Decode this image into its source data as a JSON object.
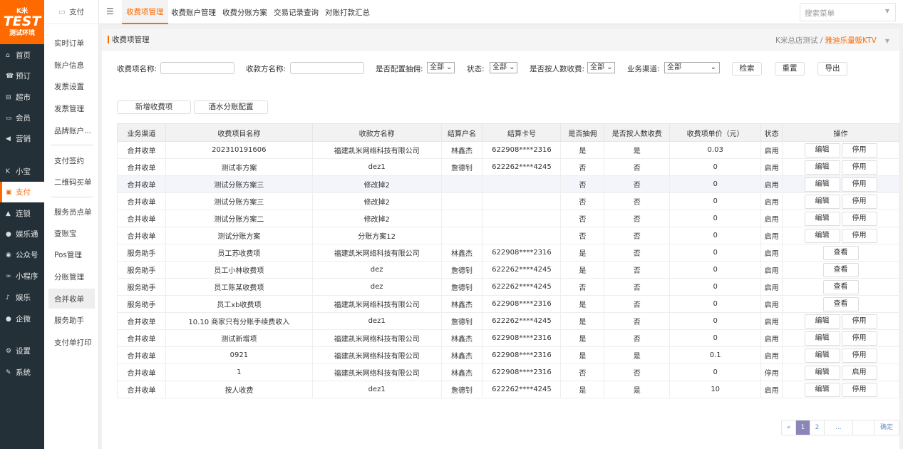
{
  "logo": {
    "top": "K米",
    "main": "TEST",
    "sub": "测试环境"
  },
  "nav": [
    {
      "label": "首页",
      "icon": "home-icon",
      "g": "⌂"
    },
    {
      "label": "预订",
      "icon": "booking-icon",
      "g": "☎"
    },
    {
      "label": "超市",
      "icon": "basket-icon",
      "g": "⊟"
    },
    {
      "label": "会员",
      "icon": "card-icon",
      "g": "▭"
    },
    {
      "label": "营销",
      "icon": "megaphone-icon",
      "g": "◀"
    },
    {
      "label": "小宝",
      "icon": "xiaobao-icon",
      "g": "K"
    },
    {
      "label": "支付",
      "icon": "payment-icon",
      "g": "▣"
    },
    {
      "label": "连锁",
      "icon": "bag-icon",
      "g": "▲"
    },
    {
      "label": "娱乐通",
      "icon": "user-icon",
      "g": "●"
    },
    {
      "label": "公众号",
      "icon": "wechat-icon",
      "g": "◉"
    },
    {
      "label": "小程序",
      "icon": "miniprogram-icon",
      "g": "∞"
    },
    {
      "label": "娱乐",
      "icon": "music-icon",
      "g": "♪"
    },
    {
      "label": "企微",
      "icon": "wecom-icon",
      "g": "●"
    },
    {
      "label": "设置",
      "icon": "gear-icon",
      "g": "⚙"
    },
    {
      "label": "系统",
      "icon": "wrench-icon",
      "g": "✎"
    }
  ],
  "subnav": {
    "title": "支付",
    "items": [
      "实时订单",
      "账户信息",
      "发票设置",
      "发票管理",
      "品牌账户...",
      "支付签约",
      "二维码买单",
      "服务员点单",
      "查账宝",
      "Pos管理",
      "分账管理",
      "合并收单",
      "服务助手",
      "支付单打印"
    ]
  },
  "tabs": [
    "收费项管理",
    "收费账户管理",
    "收费分账方案",
    "交易记录查询",
    "对账打款汇总"
  ],
  "search_placeholder": "搜索菜单",
  "page_title": "收费项管理",
  "breadcrumb": {
    "store": "K米总店测试",
    "sep": "/",
    "current": "雅迪乐量贩KTV"
  },
  "filters": {
    "item_name": "收费项名称:",
    "payee": "收款方名称:",
    "commission": "是否配置抽佣:",
    "commission_val": "全部",
    "status": "状态:",
    "status_val": "全部",
    "per_person": "是否按人数收费:",
    "per_person_val": "全部",
    "channel": "业务渠道:",
    "channel_val": "全部",
    "search": "检索",
    "reset": "重置",
    "export": "导出"
  },
  "actions": {
    "add": "新增收费项",
    "drink": "酒水分账配置"
  },
  "columns": [
    "业务渠道",
    "收费项目名称",
    "收款方名称",
    "结算户名",
    "结算卡号",
    "是否抽佣",
    "是否按人数收费",
    "收费项单价（元）",
    "状态",
    "操作"
  ],
  "rows": [
    [
      "合并收单",
      "202310191606",
      "福建凯米网络科技有限公司",
      "林鑫杰",
      "622908****2316",
      "是",
      "是",
      "0.03",
      "启用",
      [
        "编辑",
        "停用"
      ]
    ],
    [
      "合并收单",
      "测试非方案",
      "dez1",
      "詹德钊",
      "622262****4245",
      "否",
      "否",
      "0",
      "启用",
      [
        "编辑",
        "停用"
      ]
    ],
    [
      "合并收单",
      "测试分账方案三",
      "修改掉2",
      "",
      "",
      "否",
      "否",
      "0",
      "启用",
      [
        "编辑",
        "停用"
      ]
    ],
    [
      "合并收单",
      "测试分账方案三",
      "修改掉2",
      "",
      "",
      "否",
      "否",
      "0",
      "启用",
      [
        "编辑",
        "停用"
      ]
    ],
    [
      "合并收单",
      "测试分账方案二",
      "修改掉2",
      "",
      "",
      "否",
      "否",
      "0",
      "启用",
      [
        "编辑",
        "停用"
      ]
    ],
    [
      "合并收单",
      "测试分账方案",
      "分账方案12",
      "",
      "",
      "否",
      "否",
      "0",
      "启用",
      [
        "编辑",
        "停用"
      ]
    ],
    [
      "服务助手",
      "员工苏收费项",
      "福建凯米网络科技有限公司",
      "林鑫杰",
      "622908****2316",
      "是",
      "否",
      "0",
      "启用",
      [
        "查看"
      ]
    ],
    [
      "服务助手",
      "员工小林收费项",
      "dez",
      "詹德钊",
      "622262****4245",
      "是",
      "否",
      "0",
      "启用",
      [
        "查看"
      ]
    ],
    [
      "服务助手",
      "员工陈某收费项",
      "dez",
      "詹德钊",
      "622262****4245",
      "否",
      "否",
      "0",
      "启用",
      [
        "查看"
      ]
    ],
    [
      "服务助手",
      "员工xb收费项",
      "福建凯米网络科技有限公司",
      "林鑫杰",
      "622908****2316",
      "是",
      "否",
      "0",
      "启用",
      [
        "查看"
      ]
    ],
    [
      "合并收单",
      "10.10 商家只有分账手续费收入",
      "dez1",
      "詹德钊",
      "622262****4245",
      "是",
      "否",
      "0",
      "启用",
      [
        "编辑",
        "停用"
      ]
    ],
    [
      "合并收单",
      "测试新增项",
      "福建凯米网络科技有限公司",
      "林鑫杰",
      "622908****2316",
      "是",
      "否",
      "0",
      "启用",
      [
        "编辑",
        "停用"
      ]
    ],
    [
      "合并收单",
      "0921",
      "福建凯米网络科技有限公司",
      "林鑫杰",
      "622908****2316",
      "是",
      "是",
      "0.1",
      "启用",
      [
        "编辑",
        "停用"
      ]
    ],
    [
      "合并收单",
      "1",
      "福建凯米网络科技有限公司",
      "林鑫杰",
      "622908****2316",
      "否",
      "否",
      "0",
      "停用",
      [
        "编辑",
        "启用"
      ]
    ],
    [
      "合并收单",
      "按人收费",
      "dez1",
      "詹德钊",
      "622262****4245",
      "是",
      "是",
      "10",
      "启用",
      [
        "编辑",
        "停用"
      ]
    ]
  ],
  "pager": {
    "prev": "«",
    "pages": [
      "1",
      "2"
    ],
    "ellipsis": "...",
    "confirm": "确定",
    "current": "1"
  }
}
